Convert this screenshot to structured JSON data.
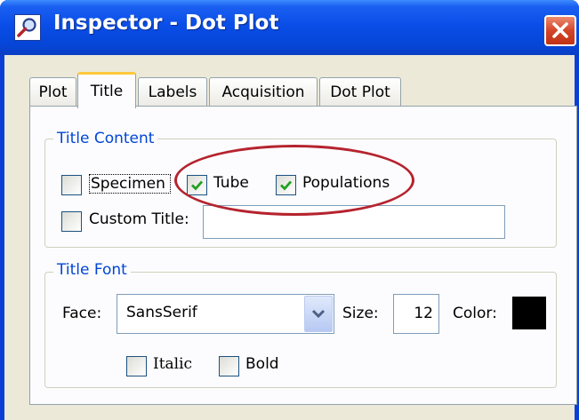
{
  "window": {
    "title": "Inspector - Dot Plot"
  },
  "tabs": [
    {
      "label": "Plot",
      "active": false
    },
    {
      "label": "Title",
      "active": true
    },
    {
      "label": "Labels",
      "active": false
    },
    {
      "label": "Acquisition",
      "active": false
    },
    {
      "label": "Dot Plot",
      "active": false
    }
  ],
  "title_content": {
    "label": "Title Content",
    "specimen": {
      "label": "Specimen",
      "checked": false
    },
    "tube": {
      "label": "Tube",
      "checked": true
    },
    "populations": {
      "label": "Populations",
      "checked": true
    },
    "custom_title": {
      "label": "Custom Title:",
      "checked": false,
      "value": ""
    }
  },
  "title_font": {
    "label": "Title Font",
    "face_label": "Face:",
    "face_value": "SansSerif",
    "size_label": "Size:",
    "size_value": "12",
    "color_label": "Color:",
    "color_value": "#000000",
    "italic": {
      "label": "Italic",
      "checked": false
    },
    "bold": {
      "label": "Bold",
      "checked": false
    }
  },
  "colors": {
    "titlebar": "#0a4ee8",
    "accent_blue": "#0046d5",
    "highlight_circle": "#b5232e",
    "check_green": "#21a121"
  },
  "icons": {
    "app": "magnifier-icon",
    "close": "close-icon",
    "dropdown": "chevron-down-icon",
    "check": "checkmark-icon"
  }
}
